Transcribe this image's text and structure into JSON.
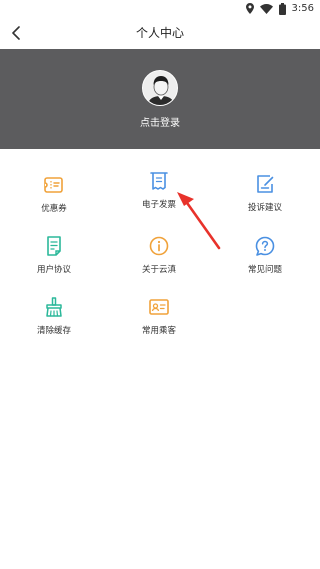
{
  "status_bar": {
    "time": "3:56",
    "icons": [
      "location-icon",
      "wifi-icon",
      "battery-icon"
    ]
  },
  "nav": {
    "title": "个人中心",
    "back_icon": "chevron-left-icon"
  },
  "profile": {
    "login_prompt": "点击登录",
    "header_color": "#5c5c5e"
  },
  "menu": {
    "items": [
      {
        "label": "优惠券",
        "icon": "coupon-icon",
        "color": "#f0a23a"
      },
      {
        "label": "电子发票",
        "icon": "receipt-icon",
        "color": "#4a90e2"
      },
      {
        "label": "投诉建议",
        "icon": "feedback-edit-icon",
        "color": "#4a90e2"
      },
      {
        "label": "用户协议",
        "icon": "document-icon",
        "color": "#2bb89a"
      },
      {
        "label": "关于云滇",
        "icon": "info-icon",
        "color": "#f0a23a"
      },
      {
        "label": "常见问题",
        "icon": "question-icon",
        "color": "#4a90e2"
      },
      {
        "label": "清除缓存",
        "icon": "broom-icon",
        "color": "#2bb89a"
      },
      {
        "label": "常用乘客",
        "icon": "id-card-icon",
        "color": "#f0a23a"
      }
    ]
  },
  "annotation": {
    "color": "#e8322b"
  }
}
